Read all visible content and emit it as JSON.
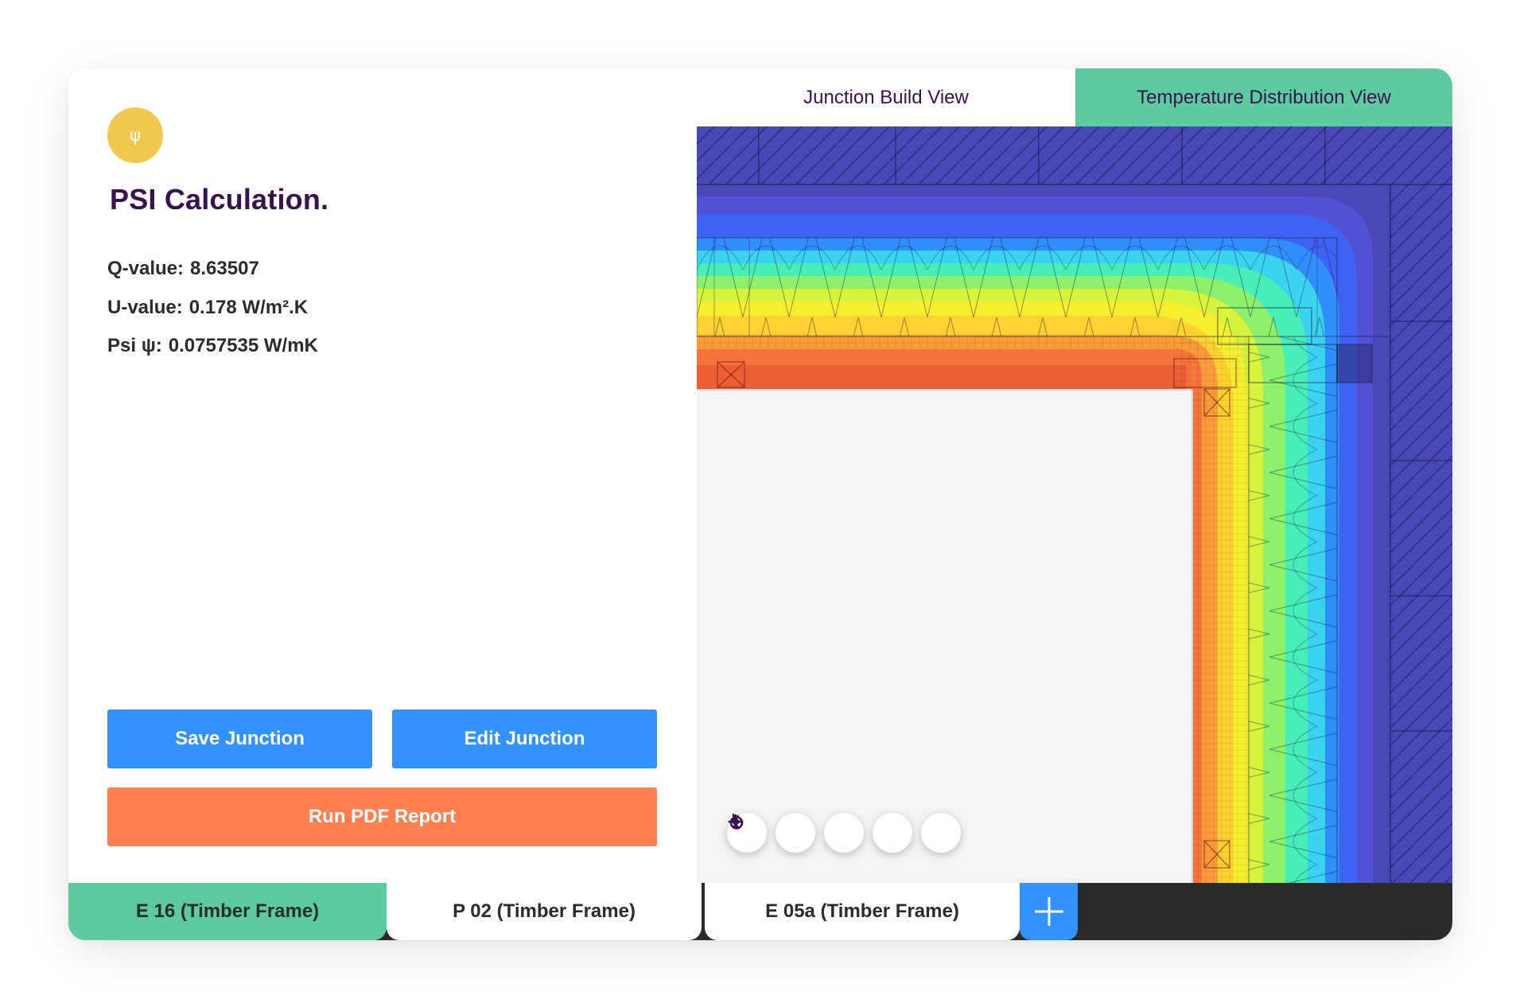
{
  "panel": {
    "logo_glyph": "ψ",
    "title": "PSI Calculation.",
    "metrics": [
      {
        "label": "Q-value:",
        "value": "8.63507"
      },
      {
        "label": "U-value:",
        "value": "0.178 W/m².K"
      },
      {
        "label": "Psi ψ:",
        "value": "0.0757535 W/mK"
      }
    ],
    "buttons": {
      "save": "Save Junction",
      "edit": "Edit Junction",
      "report": "Run PDF Report"
    }
  },
  "view_tabs": [
    {
      "label": "Junction Build View",
      "active": false
    },
    {
      "label": "Temperature Distribution View",
      "active": true
    }
  ],
  "viewer_controls": [
    {
      "name": "zoom-in-icon"
    },
    {
      "name": "zoom-out-icon"
    },
    {
      "name": "chevron-left-icon"
    },
    {
      "name": "chevron-right-icon"
    },
    {
      "name": "reset-icon"
    }
  ],
  "junction_tabs": [
    {
      "label": "E 16 (Timber Frame)",
      "active": true
    },
    {
      "label": "P 02 (Timber Frame)",
      "active": false
    },
    {
      "label": "E 05a (Timber Frame)",
      "active": false
    }
  ],
  "add_tab": {
    "icon": "plus-icon"
  },
  "colors": {
    "brand_purple": "#3b1050",
    "accent_green": "#5ccba0",
    "button_blue": "#3292ff",
    "button_orange": "#ff7f4e",
    "logo_yellow": "#f0c94f",
    "dark_bar": "#2b2b2b",
    "cold_blue": "#4848b8"
  }
}
